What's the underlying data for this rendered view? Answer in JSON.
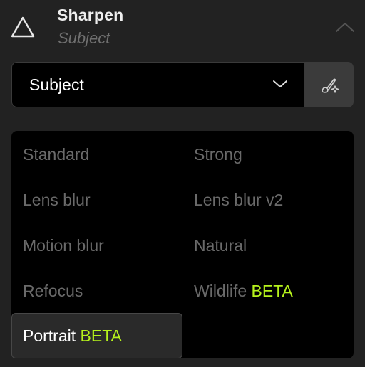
{
  "header": {
    "title": "Sharpen",
    "subtitle": "Subject",
    "tool_icon": "triangle-warning-icon",
    "collapse_icon": "chevron-up-icon"
  },
  "mode_select": {
    "value": "Subject",
    "chevron_icon": "chevron-down-icon",
    "mask_button_icon": "brush-sparkle-icon"
  },
  "models": {
    "items": [
      {
        "label": "Standard",
        "badge": "",
        "selected": false
      },
      {
        "label": "Strong",
        "badge": "",
        "selected": false
      },
      {
        "label": "Lens blur",
        "badge": "",
        "selected": false
      },
      {
        "label": "Lens blur v2",
        "badge": "",
        "selected": false
      },
      {
        "label": "Motion blur",
        "badge": "",
        "selected": false
      },
      {
        "label": "Natural",
        "badge": "",
        "selected": false
      },
      {
        "label": "Refocus",
        "badge": "",
        "selected": false
      },
      {
        "label": "Wildlife",
        "badge": "BETA",
        "selected": false
      },
      {
        "label": "Portrait",
        "badge": "BETA",
        "selected": true
      }
    ]
  },
  "colors": {
    "background": "#222222",
    "panel": "#000000",
    "beta_accent": "#b6f21c",
    "inactive_text": "#6a6a6a",
    "selected_bg": "#2a2a2a"
  }
}
